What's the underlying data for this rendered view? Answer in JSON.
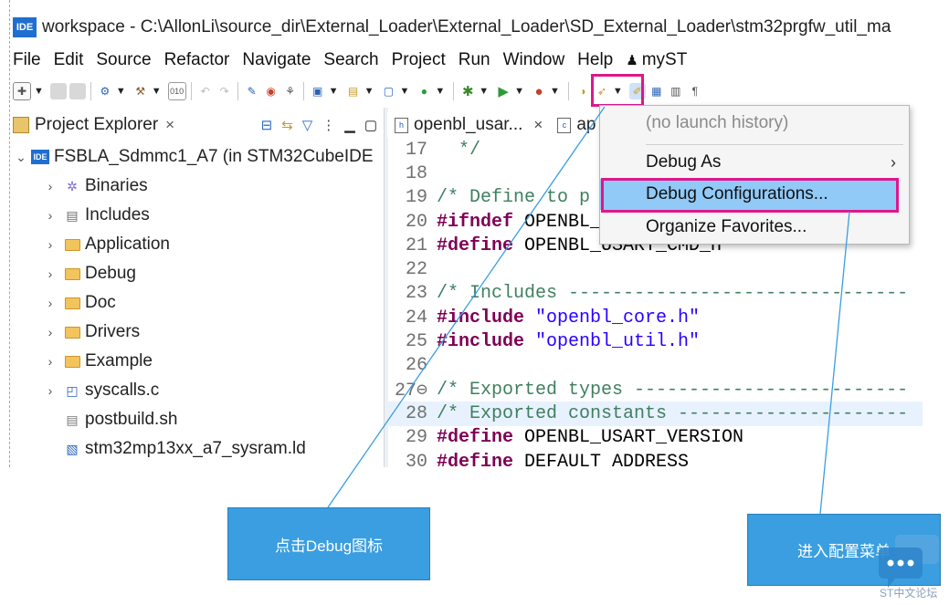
{
  "window": {
    "logo": "IDE",
    "title": "workspace - C:\\AllonLi\\source_dir\\External_Loader\\External_Loader\\SD_External_Loader\\stm32prgfw_util_ma"
  },
  "menubar": {
    "items": [
      "File",
      "Edit",
      "Source",
      "Refactor",
      "Navigate",
      "Search",
      "Project",
      "Run",
      "Window",
      "Help"
    ],
    "account": "myST"
  },
  "project_explorer": {
    "tab_label": "Project Explorer",
    "close_glyph": "×",
    "root": "FSBLA_Sdmmc1_A7 (in STM32CubeIDE",
    "items": [
      {
        "label": "Binaries",
        "icon": "binaries-icon",
        "expandable": true
      },
      {
        "label": "Includes",
        "icon": "includes-icon",
        "expandable": true
      },
      {
        "label": "Application",
        "icon": "folder-icon",
        "expandable": true
      },
      {
        "label": "Debug",
        "icon": "folder-icon",
        "expandable": true
      },
      {
        "label": "Doc",
        "icon": "folder-icon",
        "expandable": true
      },
      {
        "label": "Drivers",
        "icon": "folder-icon",
        "expandable": true
      },
      {
        "label": "Example",
        "icon": "folder-icon",
        "expandable": true
      },
      {
        "label": "syscalls.c",
        "icon": "c-file-icon",
        "expandable": true
      },
      {
        "label": "postbuild.sh",
        "icon": "text-file-icon",
        "expandable": false
      },
      {
        "label": "stm32mp13xx_a7_sysram.ld",
        "icon": "linker-file-icon",
        "expandable": false
      }
    ]
  },
  "editor": {
    "tabs": [
      {
        "label": "openbl_usar...",
        "active": true
      },
      {
        "label": "ap",
        "active": false
      }
    ],
    "lines": [
      {
        "n": "17",
        "text": "  */",
        "kind": "cmt"
      },
      {
        "n": "18",
        "text": "",
        "kind": "plain"
      },
      {
        "n": "19",
        "text": "/* Define to p",
        "kind": "cmt"
      },
      {
        "n": "20",
        "pre": "#ifndef",
        "text": " OPENBL_",
        "kind": "dir"
      },
      {
        "n": "21",
        "pre": "#define",
        "text": " OPENBL_USART_CMD_H",
        "kind": "dir"
      },
      {
        "n": "22",
        "text": "",
        "kind": "plain"
      },
      {
        "n": "23",
        "text": "/* Includes -------------------------------",
        "kind": "cmt"
      },
      {
        "n": "24",
        "pre": "#include",
        "text": " \"openbl_core.h\"",
        "kind": "inc"
      },
      {
        "n": "25",
        "pre": "#include",
        "text": " \"openbl_util.h\"",
        "kind": "inc"
      },
      {
        "n": "26",
        "text": "",
        "kind": "plain"
      },
      {
        "n": "27⊖",
        "text": "/* Exported types -------------------------",
        "kind": "cmt"
      },
      {
        "n": "28",
        "text": "/* Exported constants ---------------------",
        "kind": "cmt",
        "highlight": true
      },
      {
        "n": "29",
        "pre": "#define",
        "text": " OPENBL_USART_VERSION",
        "kind": "dir"
      },
      {
        "n": "30",
        "pre": "#define",
        "text": " DEFAULT ADDRESS",
        "kind": "dir"
      }
    ]
  },
  "debug_menu": {
    "history": "(no launch history)",
    "debug_as": "Debug As",
    "debug_as_arrow": "›",
    "configurations": "Debug Configurations...",
    "favorites": "Organize Favorites..."
  },
  "callouts": {
    "left": "点击Debug图标",
    "right": "进入配置菜单"
  },
  "watermark": "ST中文论坛",
  "colors": {
    "highlight_box": "#e0168c",
    "callout_bg": "#3a9ee0",
    "menu_selected": "#91c9f7"
  }
}
